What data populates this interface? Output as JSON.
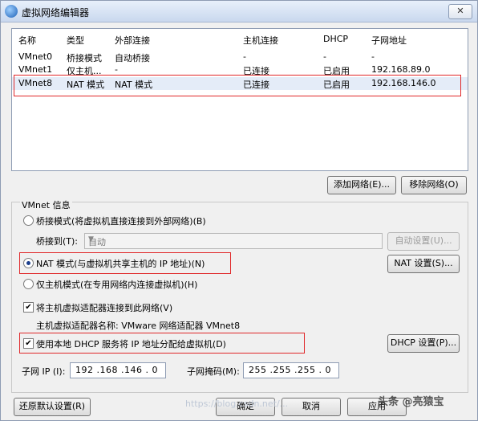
{
  "window": {
    "title": "虚拟网络编辑器",
    "close_label": "✕"
  },
  "table": {
    "headers": [
      "名称",
      "类型",
      "外部连接",
      "主机连接",
      "DHCP",
      "子网地址"
    ],
    "rows": [
      [
        "VMnet0",
        "桥接模式",
        "自动桥接",
        "-",
        "-",
        "-"
      ],
      [
        "VMnet1",
        "仅主机...",
        "-",
        "已连接",
        "已启用",
        "192.168.89.0"
      ],
      [
        "VMnet8",
        "NAT 模式",
        "NAT 模式",
        "已连接",
        "已启用",
        "192.168.146.0"
      ]
    ],
    "selected_row": 2
  },
  "buttons": {
    "add_network": "添加网络(E)...",
    "remove_network": "移除网络(O)",
    "auto_settings": "自动设置(U)...",
    "nat_settings": "NAT 设置(S)...",
    "dhcp_settings": "DHCP 设置(P)...",
    "restore_defaults": "还原默认设置(R)",
    "ok": "确定",
    "cancel": "取消",
    "apply": "应用"
  },
  "vmnet_info": {
    "group_label": "VMnet 信息",
    "bridged_mode": "桥接模式(将虚拟机直接连接到外部网络)(B)",
    "bridged_to_label": "桥接到(T):",
    "bridged_to_value": "自动",
    "nat_mode": "NAT 模式(与虚拟机共享主机的 IP 地址)(N)",
    "host_only_mode": "仅主机模式(在专用网络内连接虚拟机)(H)",
    "selected_mode": "nat",
    "connect_adapter": "将主机虚拟适配器连接到此网络(V)",
    "connect_adapter_checked": true,
    "adapter_name": "主机虚拟适配器名称: VMware 网络适配器 VMnet8",
    "use_dhcp": "使用本地 DHCP 服务将 IP 地址分配给虚拟机(D)",
    "use_dhcp_checked": true,
    "subnet_ip_label": "子网 IP (I):",
    "subnet_ip_value": "192 .168 .146 . 0",
    "subnet_mask_label": "子网掩码(M):",
    "subnet_mask_value": "255 .255 .255 . 0"
  },
  "watermark": {
    "text": "https://blog.csdn.net/...",
    "logo": "头条 @亮猿宝"
  },
  "colors": {
    "highlight_box": "#e0282a",
    "titlebar": "#c9d8ee",
    "selected_row": "#e4ecf8"
  },
  "icons": {
    "app": "network-globe-icon",
    "close": "close-icon",
    "dropdown": "chevron-down-icon",
    "check": "checkmark-icon"
  }
}
